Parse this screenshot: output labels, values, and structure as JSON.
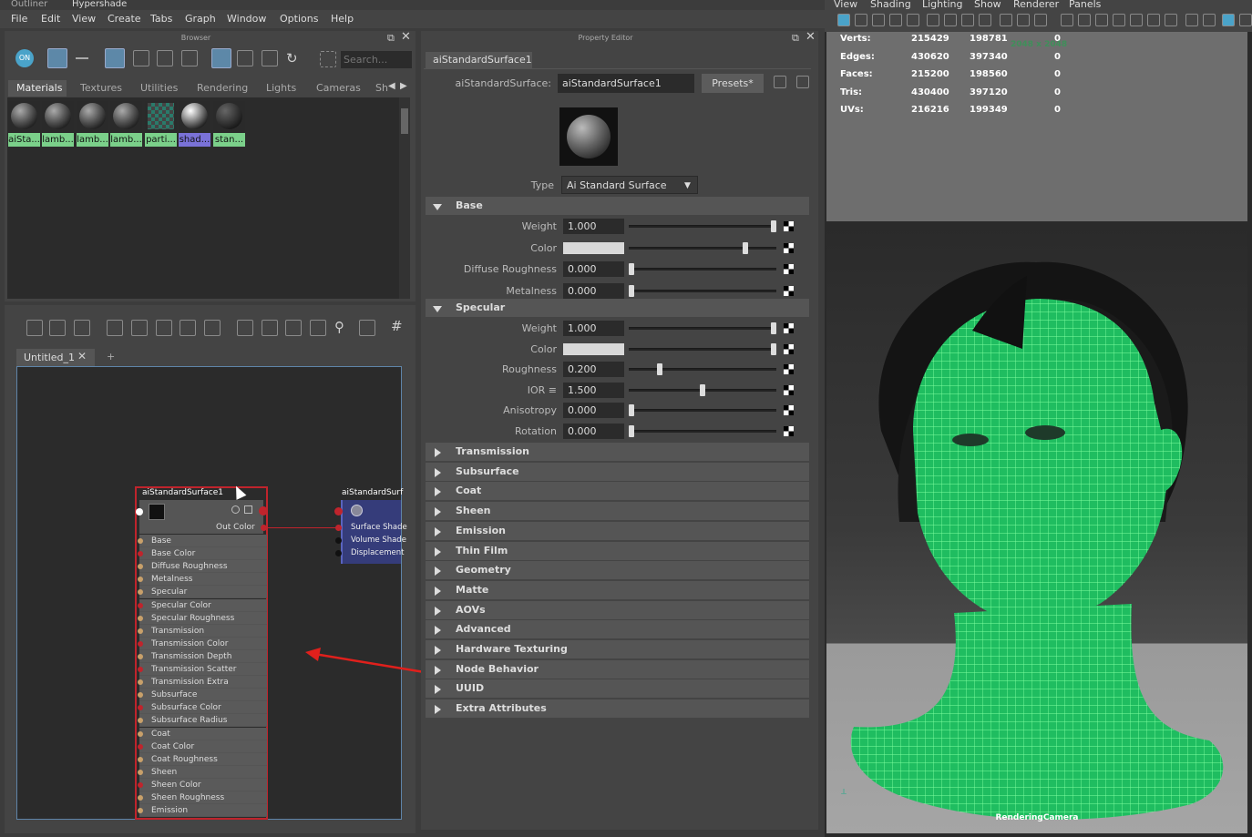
{
  "top_tabs": [
    "Outliner",
    "Hypershade"
  ],
  "menu": [
    "File",
    "Edit",
    "View",
    "Create",
    "Tabs",
    "Graph",
    "Window",
    "Options",
    "Help"
  ],
  "browser": {
    "title": "Browser",
    "search_placeholder": "Search...",
    "tabs": [
      "Materials",
      "Textures",
      "Utilities",
      "Rendering",
      "Lights",
      "Cameras",
      "Sh"
    ],
    "materials": [
      "aiSta...",
      "lamb...",
      "lamb...",
      "lamb...",
      "parti...",
      "shad...",
      "stan..."
    ]
  },
  "graph": {
    "tab_label": "Untitled_1",
    "add_tab": "+",
    "node1": {
      "title": "aiStandardSurface1",
      "out_label": "Out Color",
      "attributes": [
        "Base",
        "Base Color",
        "Diffuse Roughness",
        "Metalness",
        "Specular",
        "Specular Color",
        "Specular Roughness",
        "Transmission",
        "Transmission Color",
        "Transmission Depth",
        "Transmission Scatter",
        "Transmission Extra Roughness",
        "Subsurface",
        "Subsurface Color",
        "Subsurface Radius",
        "Coat",
        "Coat Color",
        "Coat Roughness",
        "Sheen",
        "Sheen Color",
        "Sheen Roughness",
        "Emission"
      ]
    },
    "node2": {
      "title": "aiStandardSurf",
      "inputs": [
        "Surface Shade",
        "Volume Shade",
        "Displacement"
      ]
    }
  },
  "property_editor": {
    "title": "Property Editor",
    "tab": "aiStandardSurface1",
    "node_type_label": "aiStandardSurface:",
    "node_name": "aiStandardSurface1",
    "presets": "Presets*",
    "type_label": "Type",
    "type_value": "Ai Standard Surface",
    "base": {
      "header": "Base",
      "rows": [
        {
          "label": "Weight",
          "value": "1.000",
          "level": 1.0
        },
        {
          "label": "Color",
          "value": "",
          "level": 0.8
        },
        {
          "label": "Diffuse Roughness",
          "value": "0.000",
          "level": 0.0
        },
        {
          "label": "Metalness",
          "value": "0.000",
          "level": 0.0
        }
      ]
    },
    "specular": {
      "header": "Specular",
      "rows": [
        {
          "label": "Weight",
          "value": "1.000",
          "level": 1.0
        },
        {
          "label": "Color",
          "value": "",
          "level": 1.0
        },
        {
          "label": "Roughness",
          "value": "0.200",
          "level": 0.2
        },
        {
          "label": "IOR ≡",
          "value": "1.500",
          "level": 0.5
        },
        {
          "label": "Anisotropy",
          "value": "0.000",
          "level": 0.0
        },
        {
          "label": "Rotation",
          "value": "0.000",
          "level": 0.0
        }
      ]
    },
    "collapsed_sections": [
      "Transmission",
      "Subsurface",
      "Coat",
      "Sheen",
      "Emission",
      "Thin Film",
      "Geometry",
      "Matte",
      "AOVs",
      "Advanced",
      "Hardware Texturing",
      "Node Behavior",
      "UUID",
      "Extra Attributes"
    ]
  },
  "viewport": {
    "menu": [
      "View",
      "Shading",
      "Lighting",
      "Show",
      "Renderer",
      "Panels"
    ],
    "stats": [
      {
        "label": "Verts:",
        "a": "215429",
        "b": "198781",
        "c": "0"
      },
      {
        "label": "Edges:",
        "a": "430620",
        "b": "397340",
        "c": "0"
      },
      {
        "label": "Faces:",
        "a": "215200",
        "b": "198560",
        "c": "0"
      },
      {
        "label": "Tris:",
        "a": "430400",
        "b": "397120",
        "c": "0"
      },
      {
        "label": "UVs:",
        "a": "216216",
        "b": "199349",
        "c": "0"
      }
    ],
    "resolution": "2048 x 2048",
    "camera": "RenderingCamera",
    "wire_color": "#3fff8a"
  }
}
